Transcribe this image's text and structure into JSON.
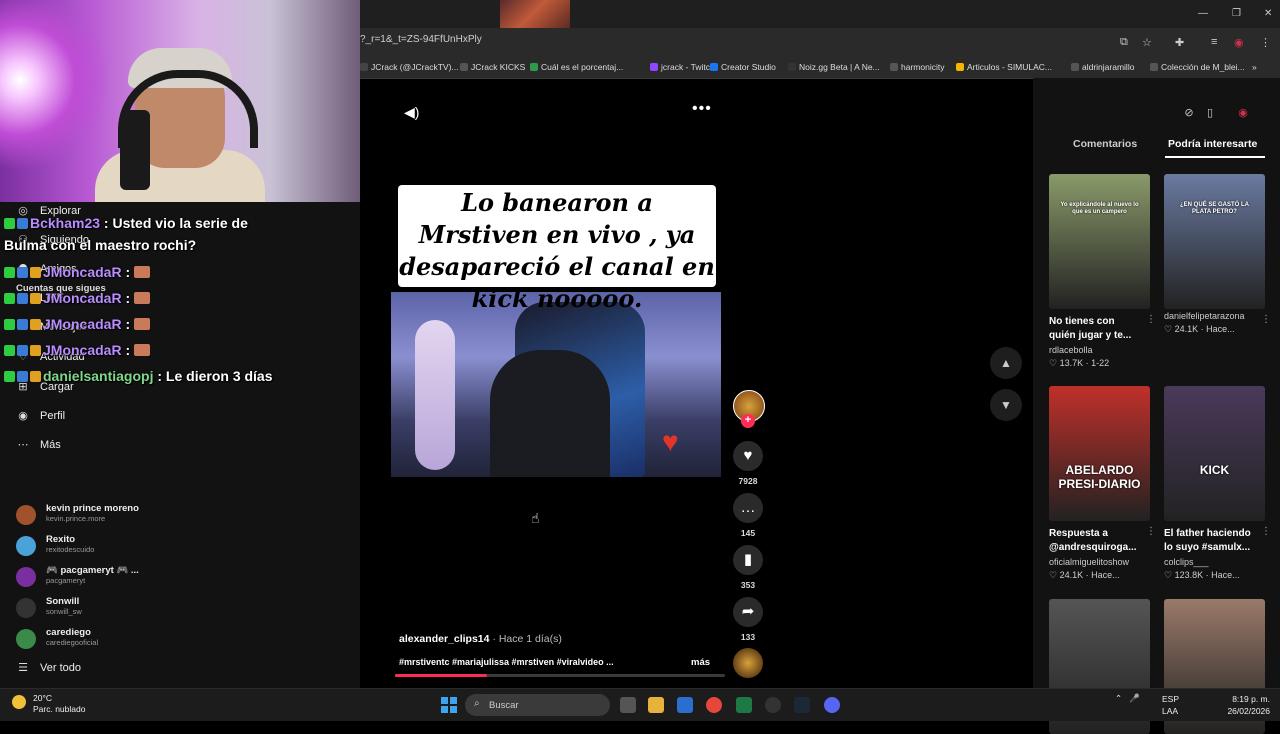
{
  "browser": {
    "url": "?_r=1&_t=ZS-94FfUnHxPly",
    "bookmarks": [
      {
        "label": "JCrack (@JCrackTV)...",
        "color": "#444444"
      },
      {
        "label": "JCrack KICKS",
        "color": "#555555"
      },
      {
        "label": "Cuál es el porcentaj...",
        "color": "#2e9b4a"
      },
      {
        "label": "jcrack - Twitch",
        "color": "#9146ff"
      },
      {
        "label": "Creator Studio",
        "color": "#1877f2"
      },
      {
        "label": "Noiz.gg Beta | A Ne...",
        "color": "#333333"
      },
      {
        "label": "harmonicity",
        "color": "#555555"
      },
      {
        "label": "Articulos - SIMULAC...",
        "color": "#f4b400"
      },
      {
        "label": "aldrinjaramillo",
        "color": "#555555"
      },
      {
        "label": "Colección de M_blei...",
        "color": "#555555"
      }
    ]
  },
  "nav": {
    "items": [
      {
        "label": "Explorar",
        "icon": "compass-icon"
      },
      {
        "label": "Siguiendo",
        "icon": "following-icon"
      },
      {
        "label": "Amigos",
        "icon": "friends-icon"
      },
      {
        "label": "LIVE",
        "icon": "live-icon"
      },
      {
        "label": "Mensajes",
        "icon": "messages-icon"
      },
      {
        "label": "Actividad",
        "icon": "activity-icon"
      },
      {
        "label": "Cargar",
        "icon": "upload-icon"
      },
      {
        "label": "Perfil",
        "icon": "profile-icon"
      },
      {
        "label": "Más",
        "icon": "more-icon"
      }
    ],
    "following_title": "Cuentas que sigues",
    "accounts": [
      {
        "name": "kevin prince moreno",
        "handle": "kevin.prince.more",
        "color": "#a0522d"
      },
      {
        "name": "Rexito",
        "handle": "rexitodescuido",
        "color": "#4aa3d8"
      },
      {
        "name": "🎮 pacgameryt 🎮 ...",
        "handle": "pacgameryt",
        "color": "#7a2fa0"
      },
      {
        "name": "Sonwill",
        "handle": "sonwill_sw",
        "color": "#333333"
      },
      {
        "name": "carediego",
        "handle": "carediegooficial",
        "color": "#3a8a4a"
      }
    ],
    "see_all": "Ver todo"
  },
  "chat": [
    {
      "user": "Bckham23",
      "sep": " : ",
      "msg": "Usted vio la serie de",
      "user_color": "purple"
    },
    {
      "user": "",
      "sep": "",
      "msg": "Bulma con el maestro rochi?",
      "user_color": "purple"
    },
    {
      "user": "JMoncadaR",
      "sep": " : ",
      "msg": "",
      "user_color": "purple"
    },
    {
      "user": "JMoncadaR",
      "sep": " : ",
      "msg": "",
      "user_color": "purple"
    },
    {
      "user": "JMoncadaR",
      "sep": " : ",
      "msg": "",
      "user_color": "purple"
    },
    {
      "user": "JMoncadaR",
      "sep": " : ",
      "msg": "",
      "user_color": "purple"
    },
    {
      "user": "danielsantiagopj",
      "sep": " : ",
      "msg": "Le dieron 3 días",
      "user_color": "green"
    }
  ],
  "video": {
    "caption": "Lo banearon a Mrstiven en vivo , ya desapareció el canal en kick nooooo.",
    "author": "alexander_clips14",
    "time": " · Hace 1 día(s)",
    "hashtags": "#mrstiventc #mariajulissa #mrstiven #viralvideo ...",
    "more_label": "más",
    "progress": 0.28,
    "likes": "7928",
    "comments": "145",
    "saves": "353",
    "shares": "133"
  },
  "right_panel": {
    "tabs": [
      "Comentarios",
      "Podría interesarte"
    ],
    "active_tab": 1,
    "cards": [
      {
        "title": "No tienes con quién jugar y te...",
        "account": "rdlacebolla",
        "stat": "♡ 13.7K · 1-22",
        "thumb": "#8a9a6a",
        "thumb_text": "Yo explicándole al nuevo lo que es un campero"
      },
      {
        "title": "",
        "account": "danielfelipetarazona",
        "stat": "♡ 24.1K · Hace...",
        "thumb": "#6a7aa0",
        "thumb_text": "¿EN QUÉ SE GASTÓ LA PLATA PETRO?"
      },
      {
        "title": "Respuesta a @andresquiroga...",
        "account": "oficialmiguelitoshow",
        "stat": "♡ 24.1K · Hace...",
        "thumb": "#c0302a",
        "thumb_text": "ABELARDO PRESI-DIARIO"
      },
      {
        "title": "El father haciendo lo suyo #samulx...",
        "account": "colclips___",
        "stat": "♡ 123.8K · Hace...",
        "thumb": "#4a3a5a",
        "thumb_text": "KICK"
      },
      {
        "title": "",
        "account": "",
        "stat": "",
        "thumb": "#555555",
        "thumb_text": ""
      },
      {
        "title": "",
        "account": "",
        "stat": "",
        "thumb": "#9a7a6a",
        "thumb_text": ""
      }
    ]
  },
  "taskbar": {
    "temp": "20°C",
    "weather": "Parc. nublado",
    "search_placeholder": "Buscar",
    "lang1": "ESP",
    "lang2": "LAA",
    "time": "8:19 p. m.",
    "date": "26/02/2026"
  }
}
